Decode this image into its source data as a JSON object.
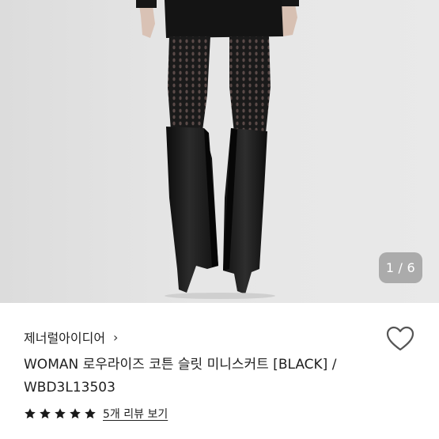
{
  "product": {
    "image_counter": {
      "current": "1",
      "separator": "/",
      "total": "6"
    },
    "brand": "제너럴아이디어",
    "brand_chevron": "›",
    "title": "WOMAN 로우라이즈 코튼 슬릿 미니스커트 [BLACK] / WBD3L13503",
    "rating": {
      "stars": 5,
      "max": 5,
      "reviews_link": "5개 리뷰 보기"
    },
    "wishlist_icon": "heart-outline-icon",
    "star_icon": "star-filled-icon"
  },
  "colors": {
    "star": "#1a1a1a",
    "heart_stroke": "#555555"
  }
}
